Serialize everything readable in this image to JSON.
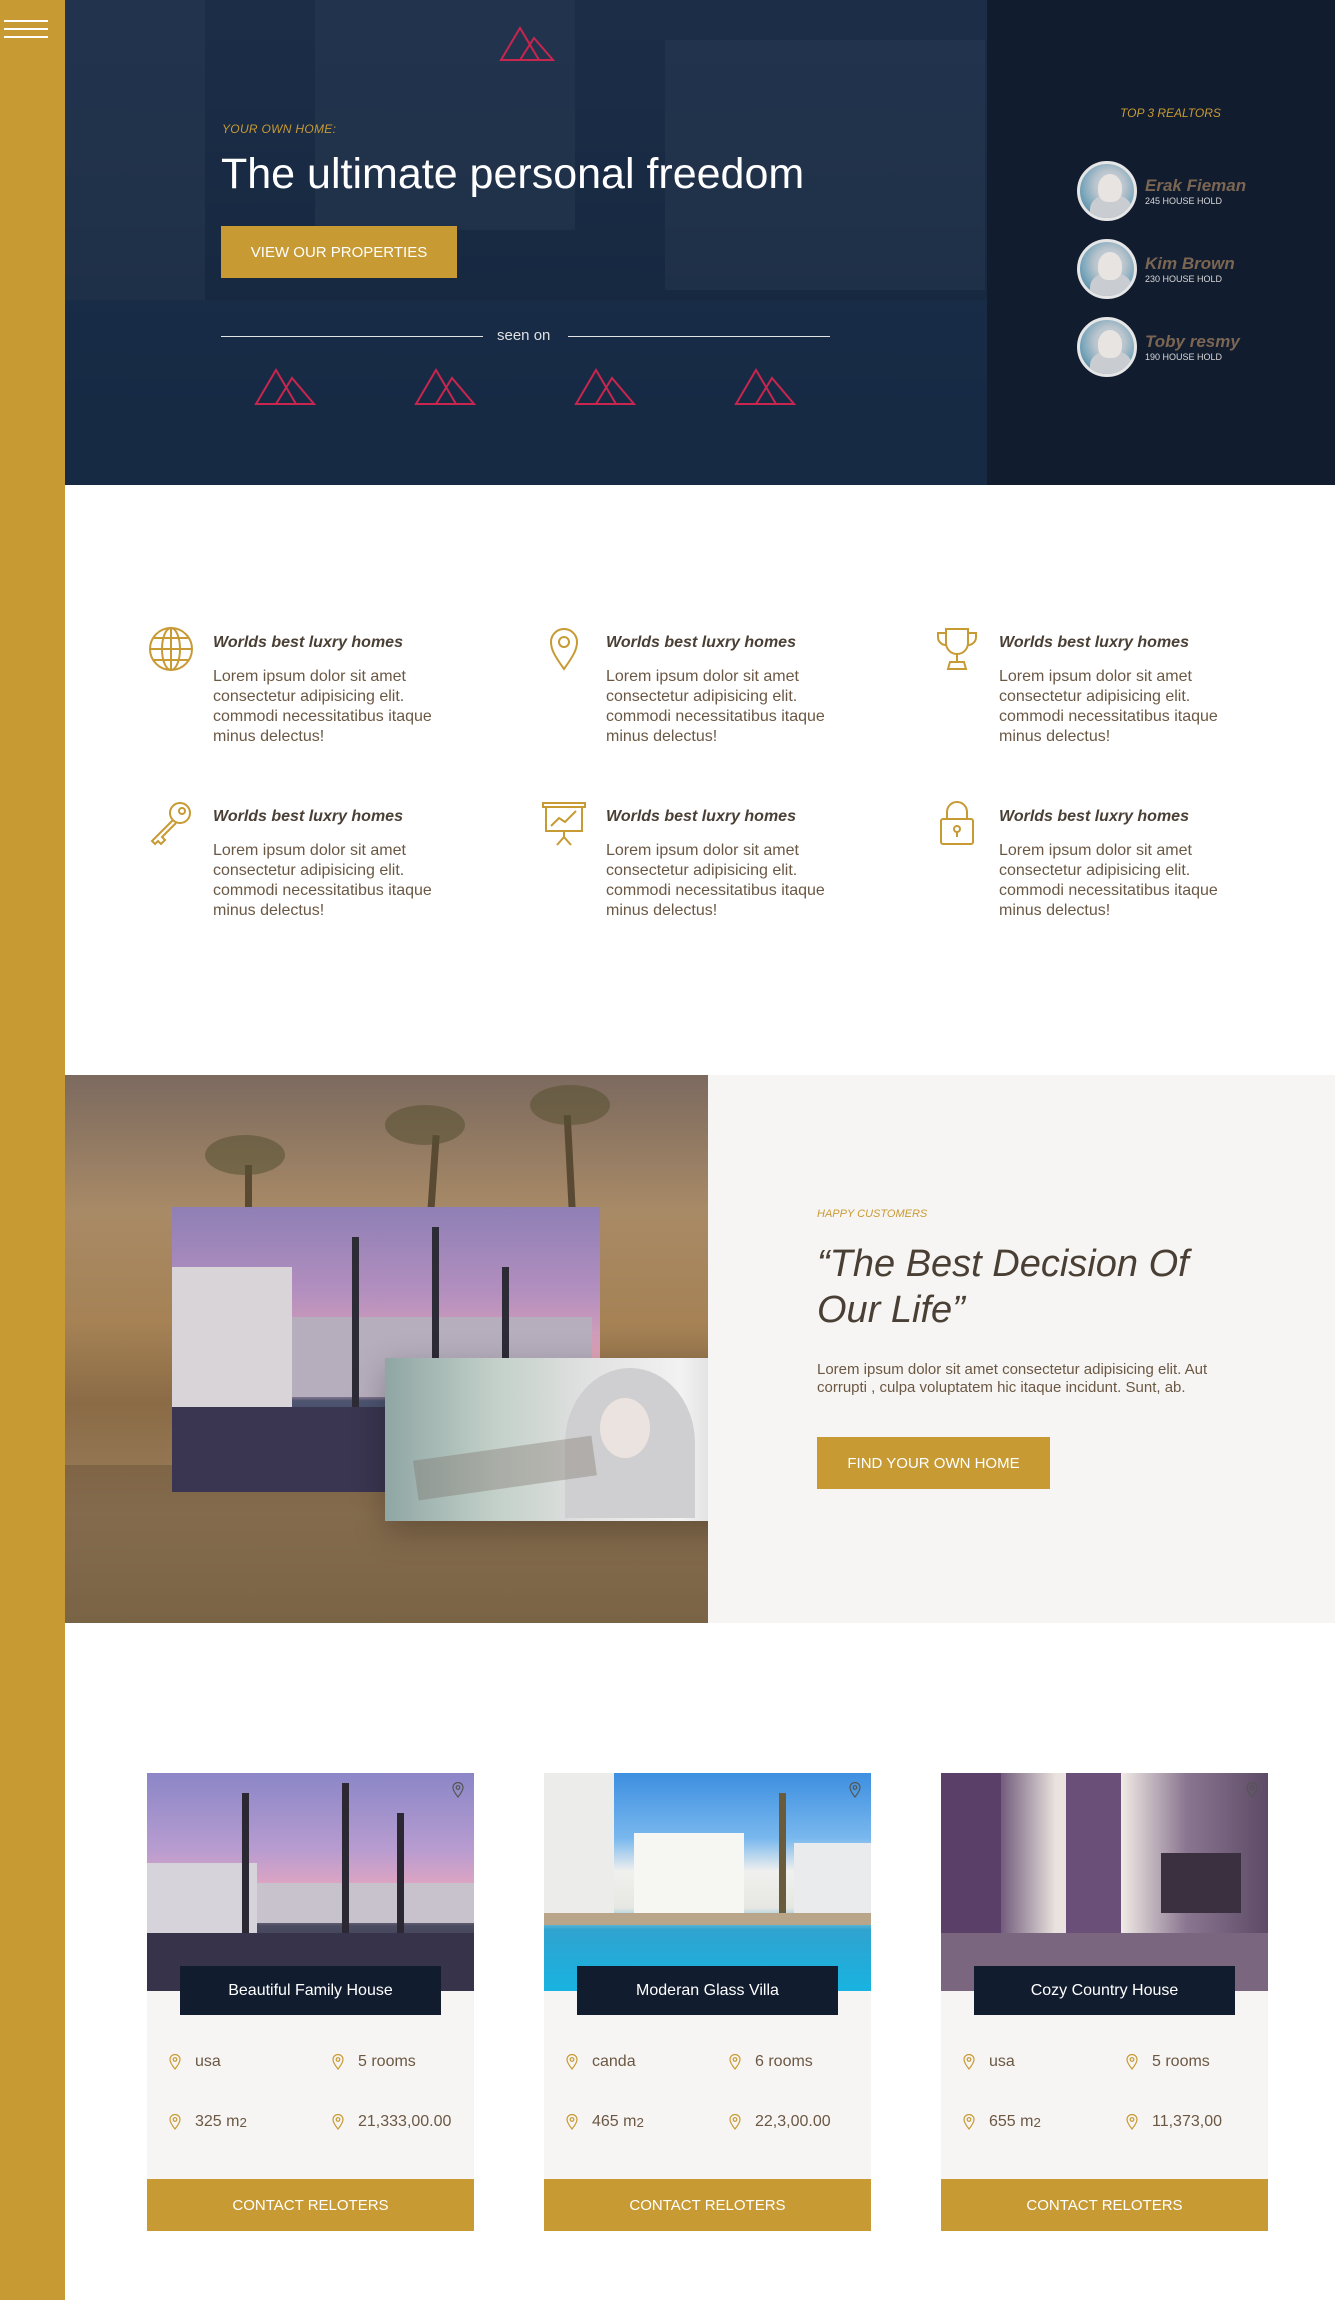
{
  "colors": {
    "accent": "#c79a34",
    "navy": "#111c2e",
    "brand_red": "#c8254f",
    "text": "#4a3f35"
  },
  "sidebar": {
    "menu_icon": "hamburger-menu-icon"
  },
  "hero": {
    "eyebrow": "YOUR OWN HOME:",
    "title": "The ultimate personal freedom",
    "button_label": "VIEW OUR PROPERTIES",
    "seen_on": "seen on"
  },
  "realtors": {
    "title": "TOP 3 REALTORS",
    "items": [
      {
        "name": "Erak Fieman",
        "count": "245 HOUSE HOLD"
      },
      {
        "name": "Kim Brown",
        "count": "230 HOUSE HOLD"
      },
      {
        "name": "Toby resmy",
        "count": "190 HOUSE HOLD"
      }
    ]
  },
  "features": [
    {
      "icon": "globe-icon",
      "title": "Worlds best luxry homes",
      "text": "Lorem ipsum dolor sit amet consectetur adipisicing elit. commodi necessitatibus itaque minus delectus!"
    },
    {
      "icon": "map-pin-icon",
      "title": "Worlds best luxry homes",
      "text": "Lorem ipsum dolor sit amet consectetur adipisicing elit. commodi necessitatibus itaque minus delectus!"
    },
    {
      "icon": "trophy-icon",
      "title": "Worlds best luxry homes",
      "text": "Lorem ipsum dolor sit amet consectetur adipisicing elit. commodi necessitatibus itaque minus delectus!"
    },
    {
      "icon": "key-icon",
      "title": "Worlds best luxry homes",
      "text": "Lorem ipsum dolor sit amet consectetur adipisicing elit. commodi necessitatibus itaque minus delectus!"
    },
    {
      "icon": "presentation-chart-icon",
      "title": "Worlds best luxry homes",
      "text": "Lorem ipsum dolor sit amet consectetur adipisicing elit. commodi necessitatibus itaque minus delectus!"
    },
    {
      "icon": "padlock-icon",
      "title": "Worlds best luxry homes",
      "text": "Lorem ipsum dolor sit amet consectetur adipisicing elit. commodi necessitatibus itaque minus delectus!"
    }
  ],
  "story": {
    "eyebrow": "HAPPY CUSTOMERS",
    "quote": "“The Best Decision Of Our Life”",
    "body": "Lorem ipsum dolor sit amet consectetur adipisicing elit. Aut corrupti , culpa voluptatem hic itaque incidunt. Sunt, ab.",
    "button_label": "FIND YOUR OWN HOME"
  },
  "properties": [
    {
      "title": "Beautiful Family House",
      "location": "usa",
      "rooms": "5 rooms",
      "area": "325 m",
      "area_sup": "2",
      "price": "21,333,00.00",
      "button_label": "CONTACT RELOTERS"
    },
    {
      "title": "Moderan Glass Villa",
      "location": "canda",
      "rooms": "6 rooms",
      "area": "465 m",
      "area_sup": "2",
      "price": "22,3,00.00",
      "button_label": "CONTACT RELOTERS"
    },
    {
      "title": "Cozy Country House",
      "location": "usa",
      "rooms": "5 rooms",
      "area": "655 m",
      "area_sup": "2",
      "price": "11,373,00",
      "button_label": "CONTACT RELOTERS"
    }
  ]
}
